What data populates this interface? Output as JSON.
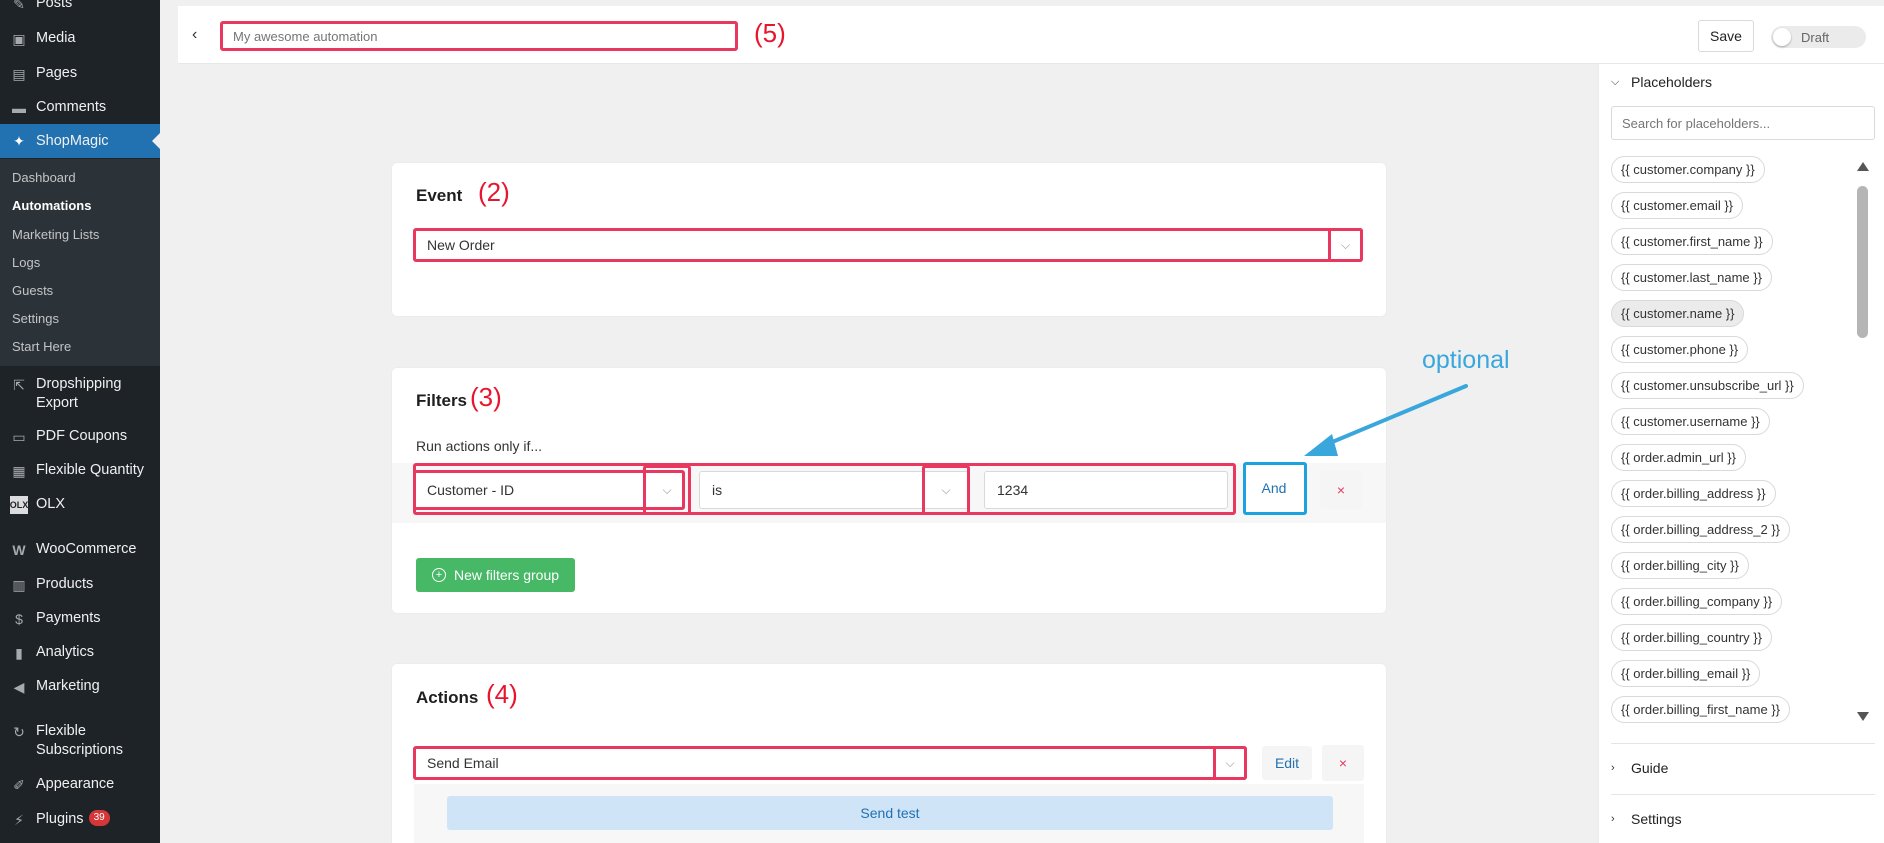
{
  "sidebar": {
    "items": [
      {
        "label": "Posts",
        "icon": "pin-icon"
      },
      {
        "label": "Media",
        "icon": "media-icon"
      },
      {
        "label": "Pages",
        "icon": "pages-icon"
      },
      {
        "label": "Comments",
        "icon": "comments-icon"
      },
      {
        "label": "ShopMagic",
        "icon": "magic-wand-icon"
      }
    ],
    "submenu": [
      "Dashboard",
      "Automations",
      "Marketing Lists",
      "Logs",
      "Guests",
      "Settings",
      "Start Here"
    ],
    "items_after": [
      {
        "label": "Dropshipping Export",
        "line1": "Dropshipping",
        "line2": "Export",
        "icon": "external-link-icon"
      },
      {
        "label": "PDF Coupons",
        "icon": "coupon-icon"
      },
      {
        "label": "Flexible Quantity",
        "icon": "grid-icon"
      },
      {
        "label": "OLX",
        "icon": "olx-icon"
      },
      {
        "label": "WooCommerce",
        "icon": "woo-icon"
      },
      {
        "label": "Products",
        "icon": "box-icon"
      },
      {
        "label": "Payments",
        "icon": "dollar-icon"
      },
      {
        "label": "Analytics",
        "icon": "bar-chart-icon"
      },
      {
        "label": "Marketing",
        "icon": "megaphone-icon"
      },
      {
        "label": "Flexible Subscriptions",
        "line1": "Flexible",
        "line2": "Subscriptions",
        "icon": "subscription-icon"
      },
      {
        "label": "Appearance",
        "icon": "brush-icon"
      },
      {
        "label": "Plugins",
        "icon": "plugin-icon",
        "badge": "39"
      }
    ]
  },
  "topbar": {
    "title_placeholder": "My awesome automation",
    "save_label": "Save",
    "draft_label": "Draft",
    "annotation": "(5)"
  },
  "event": {
    "title": "Event",
    "annotation": "(2)",
    "selected": "New Order"
  },
  "filters": {
    "title": "Filters",
    "annotation": "(3)",
    "intro": "Run actions only if...",
    "field": "Customer - ID",
    "operator": "is",
    "value": "1234",
    "and_label": "And",
    "remove_label": "×",
    "new_group_label": "New filters group",
    "optional_note": "optional"
  },
  "actions": {
    "title": "Actions",
    "annotation": "(4)",
    "selected": "Send Email",
    "edit_label": "Edit",
    "remove_label": "×",
    "send_test_label": "Send test"
  },
  "rightpanel": {
    "placeholders_title": "Placeholders",
    "search_placeholder": "Search for placeholders...",
    "chips": [
      "{{ customer.company }}",
      "{{ customer.email }}",
      "{{ customer.first_name }}",
      "{{ customer.last_name }}",
      "{{ customer.name }}",
      "{{ customer.phone }}",
      "{{ customer.unsubscribe_url }}",
      "{{ customer.username }}",
      "{{ order.admin_url }}",
      "{{ order.billing_address }}",
      "{{ order.billing_address_2 }}",
      "{{ order.billing_city }}",
      "{{ order.billing_company }}",
      "{{ order.billing_country }}",
      "{{ order.billing_email }}",
      "{{ order.billing_first_name }}"
    ],
    "guide_title": "Guide",
    "settings_title": "Settings"
  },
  "colors": {
    "sidebar_bg": "#1d2327",
    "accent": "#2271b1",
    "highlight": "#e8385f",
    "highlight_blue": "#1aa3e0",
    "green_button": "#46b866"
  }
}
